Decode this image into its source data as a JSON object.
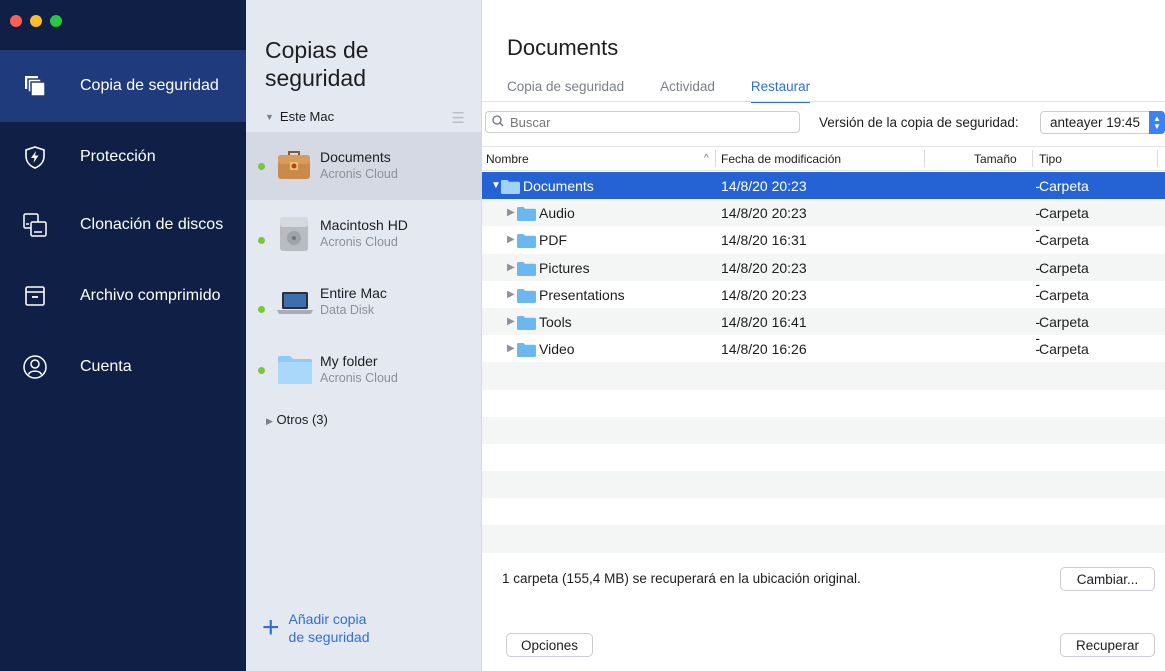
{
  "window": {
    "traffic_colors": [
      "#ff5f57",
      "#febc2e",
      "#28c840"
    ]
  },
  "nav": {
    "items": [
      {
        "label": "Copia de seguridad",
        "icon": "backup-copies-icon",
        "active": true
      },
      {
        "label": "Protección",
        "icon": "shield-bolt-icon",
        "active": false
      },
      {
        "label": "Clonación de discos",
        "icon": "disk-clone-icon",
        "active": false
      },
      {
        "label": "Archivo comprimido",
        "icon": "archive-box-icon",
        "active": false
      },
      {
        "label": "Cuenta",
        "icon": "account-user-icon",
        "active": false
      }
    ]
  },
  "backups": {
    "title": "Copias de seguridad",
    "section": "Este Mac",
    "items": [
      {
        "name": "Documents",
        "location": "Acronis Cloud",
        "icon": "briefcase-icon",
        "selected": true
      },
      {
        "name": "Macintosh HD",
        "location": "Acronis Cloud",
        "icon": "hard-drive-icon",
        "selected": false
      },
      {
        "name": "Entire Mac",
        "location": "Data Disk",
        "icon": "laptop-icon",
        "selected": false
      },
      {
        "name": "My folder",
        "location": "Acronis Cloud",
        "icon": "folder-icon",
        "selected": false
      }
    ],
    "others": "Otros (3)",
    "add_line1": "Añadir copia",
    "add_line2": "de seguridad"
  },
  "main": {
    "title": "Documents",
    "tabs": [
      {
        "label": "Copia de seguridad",
        "active": false
      },
      {
        "label": "Actividad",
        "active": false
      },
      {
        "label": "Restaurar",
        "active": true
      }
    ],
    "search_placeholder": "Buscar",
    "version_label": "Versión de la copia de seguridad:",
    "version_value": "anteayer 19:45",
    "columns": {
      "name": "Nombre",
      "modified": "Fecha de modificación",
      "size": "Tamaño",
      "type": "Tipo"
    },
    "rows": [
      {
        "name": "Documents",
        "modified": "14/8/20 20:23",
        "size": "--",
        "type": "Carpeta",
        "expanded": true,
        "selected": true,
        "level": 0
      },
      {
        "name": "Audio",
        "modified": "14/8/20 20:23",
        "size": "--",
        "type": "Carpeta",
        "expanded": false,
        "selected": false,
        "level": 1
      },
      {
        "name": "PDF",
        "modified": "14/8/20 16:31",
        "size": "--",
        "type": "Carpeta",
        "expanded": false,
        "selected": false,
        "level": 1
      },
      {
        "name": "Pictures",
        "modified": "14/8/20 20:23",
        "size": "--",
        "type": "Carpeta",
        "expanded": false,
        "selected": false,
        "level": 1
      },
      {
        "name": "Presentations",
        "modified": "14/8/20 20:23",
        "size": "--",
        "type": "Carpeta",
        "expanded": false,
        "selected": false,
        "level": 1
      },
      {
        "name": "Tools",
        "modified": "14/8/20 16:41",
        "size": "--",
        "type": "Carpeta",
        "expanded": false,
        "selected": false,
        "level": 1
      },
      {
        "name": "Video",
        "modified": "14/8/20 16:26",
        "size": "--",
        "type": "Carpeta",
        "expanded": false,
        "selected": false,
        "level": 1
      }
    ],
    "empty_row_count": 7,
    "summary": "1 carpeta (155,4 MB) se recuperará en la ubicación original.",
    "change_button": "Cambiar...",
    "options_button": "Opciones",
    "recover_button": "Recuperar"
  },
  "colors": {
    "nav_bg": "#0f1f45",
    "nav_active": "#203b7c",
    "accent": "#2f6fd6",
    "selection": "#2563d4",
    "status_ok": "#7cc43a",
    "folder": "#6bb7f0"
  }
}
